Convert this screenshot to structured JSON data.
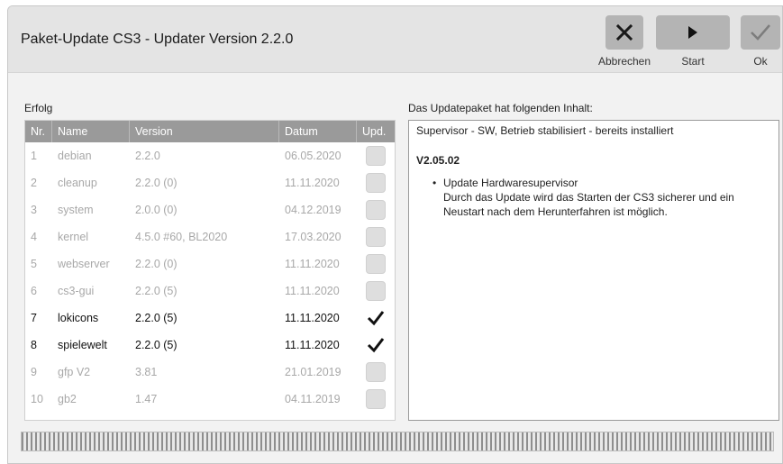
{
  "window": {
    "title": "Paket-Update CS3 - Updater Version 2.2.0"
  },
  "toolbar": {
    "cancel_label": "Abbrechen",
    "start_label": "Start",
    "ok_label": "Ok"
  },
  "left": {
    "label": "Erfolg",
    "columns": [
      "Nr.",
      "Name",
      "Version",
      "Datum",
      "Upd."
    ],
    "rows": [
      {
        "nr": "1",
        "name": "debian",
        "version": "2.2.0",
        "date": "06.05.2020",
        "checked": false,
        "active": false
      },
      {
        "nr": "2",
        "name": "cleanup",
        "version": "2.2.0 (0)",
        "date": "11.11.2020",
        "checked": false,
        "active": false
      },
      {
        "nr": "3",
        "name": "system",
        "version": "2.0.0 (0)",
        "date": "04.12.2019",
        "checked": false,
        "active": false
      },
      {
        "nr": "4",
        "name": "kernel",
        "version": "4.5.0 #60, BL2020",
        "date": "17.03.2020",
        "checked": false,
        "active": false
      },
      {
        "nr": "5",
        "name": "webserver",
        "version": "2.2.0 (0)",
        "date": "11.11.2020",
        "checked": false,
        "active": false
      },
      {
        "nr": "6",
        "name": "cs3-gui",
        "version": "2.2.0 (5)",
        "date": "11.11.2020",
        "checked": false,
        "active": false
      },
      {
        "nr": "7",
        "name": "lokicons",
        "version": "2.2.0 (5)",
        "date": "11.11.2020",
        "checked": true,
        "active": true
      },
      {
        "nr": "8",
        "name": "spielewelt",
        "version": "2.2.0 (5)",
        "date": "11.11.2020",
        "checked": true,
        "active": true
      },
      {
        "nr": "9",
        "name": "gfp V2",
        "version": "3.81",
        "date": "21.01.2019",
        "checked": false,
        "active": false
      },
      {
        "nr": "10",
        "name": "gb2",
        "version": "1.47",
        "date": "04.11.2019",
        "checked": false,
        "active": false
      }
    ]
  },
  "right": {
    "label": "Das Updatepaket hat folgenden Inhalt:",
    "header": "Supervisor - SW, Betrieb stabilisiert - bereits installiert",
    "version": "V2.05.02",
    "bullet_title": "Update Hardwaresupervisor",
    "bullet_text": "Durch das Update wird das Starten der CS3 sicherer und ein Neustart nach dem Herunterfahren ist möglich."
  },
  "icons": {
    "cancel": "close-icon",
    "start": "play-icon",
    "ok": "checkmark-icon"
  },
  "colors": {
    "toolbar_button": "#b4b4b4",
    "table_header": "#9a9a9a",
    "dim_text": "#a8a8a8"
  }
}
